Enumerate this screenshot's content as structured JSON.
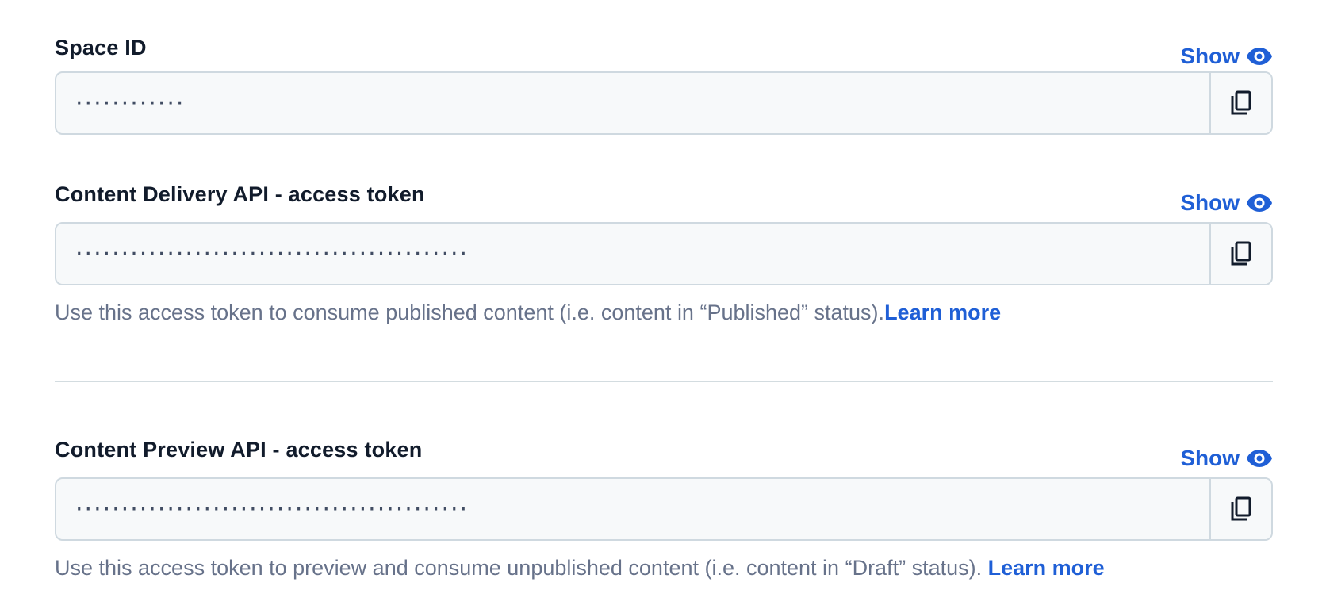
{
  "fields": [
    {
      "label": "Space ID",
      "show_label": "Show",
      "masked_value": "············",
      "show_icon": "eye-icon",
      "copy_icon": "copy-icon"
    },
    {
      "label": "Content Delivery API - access token",
      "show_label": "Show",
      "masked_value": "···········································",
      "show_icon": "eye-icon",
      "copy_icon": "copy-icon",
      "help_text": "Use this access token to consume published content (i.e. content in “Published” status).",
      "help_link": "Learn more"
    },
    {
      "label": "Content Preview API - access token",
      "show_label": "Show",
      "masked_value": "···········································",
      "show_icon": "eye-icon",
      "copy_icon": "copy-icon",
      "help_text": "Use this access token to preview and consume unpublished content (i.e. content in “Draft” status). ",
      "help_link": "Learn more"
    }
  ],
  "colors": {
    "accent": "#1f5fd6",
    "label": "#111b2b",
    "muted": "#67728a",
    "border": "#cfd9e0",
    "input_bg": "#f7f9fa"
  }
}
